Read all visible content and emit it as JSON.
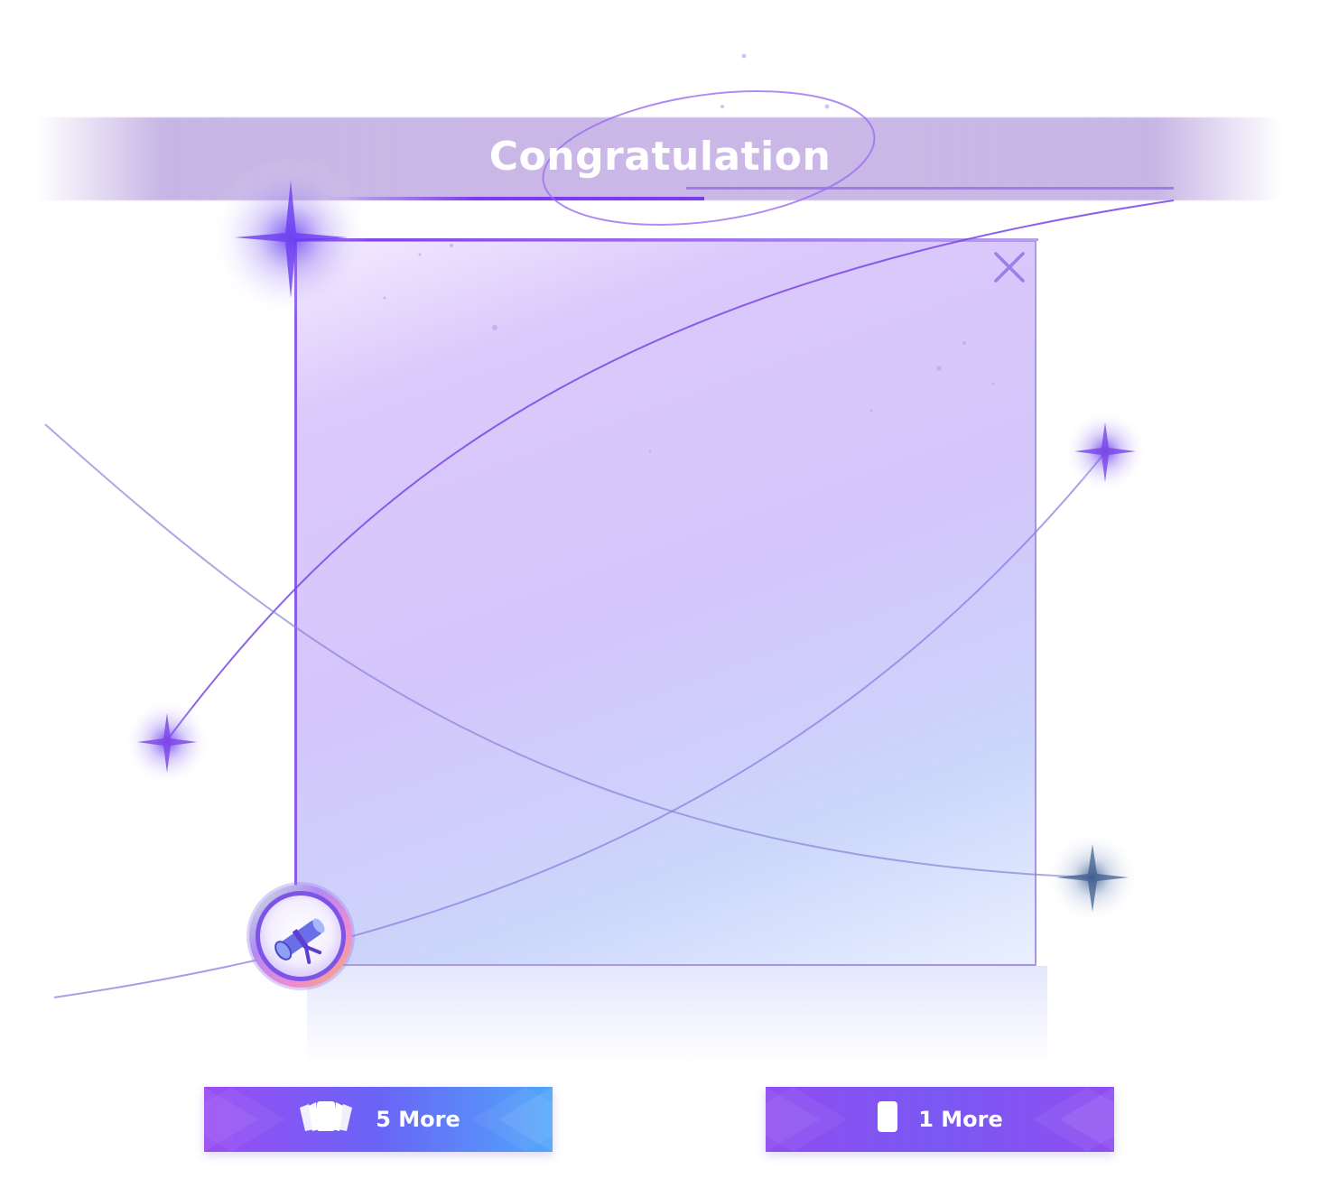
{
  "dialog": {
    "title": "Congratulation",
    "close_icon": "close-icon",
    "badge_icon": "scroll-icon"
  },
  "buttons": {
    "five_more_label": "5 More",
    "five_more_icon": "cards-fan-icon",
    "one_more_label": "1 More",
    "one_more_icon": "single-card-icon"
  },
  "colors": {
    "accent": "#7c3aed",
    "panel_top": "#dcc8fb",
    "panel_bottom": "#cbd6fb",
    "button_five_start": "#9a4cf3",
    "button_five_end": "#4fa6fb",
    "button_one": "#8f4df1"
  }
}
